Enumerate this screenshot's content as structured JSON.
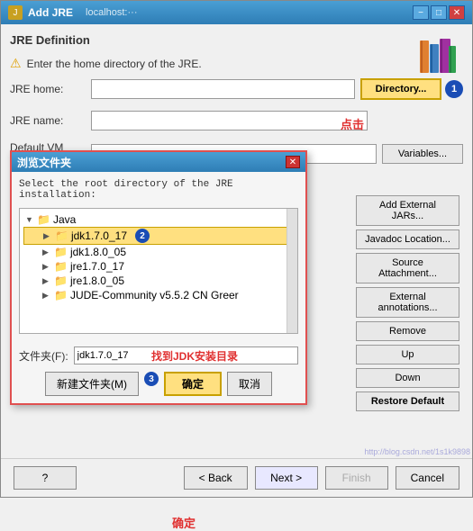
{
  "window": {
    "title": "Add JRE",
    "title_extra": "localhost:···",
    "close_label": "✕",
    "minimize_label": "−",
    "maximize_label": "□"
  },
  "section": {
    "title": "JRE Definition",
    "warning": "Enter the home directory of the JRE."
  },
  "form": {
    "jre_home_label": "JRE home:",
    "jre_name_label": "JRE name:",
    "default_vm_label": "Default VM arguments:"
  },
  "buttons": {
    "directory_label": "Directory...",
    "variables_label": "Variables...",
    "add_external_jars_label": "Add External JARs...",
    "javadoc_location_label": "Javadoc Location...",
    "source_attachment_label": "Source Attachment...",
    "external_annotations_label": "External annotations...",
    "remove_label": "Remove",
    "up_label": "Up",
    "down_label": "Down",
    "restore_default_label": "Restore Default"
  },
  "browse_dialog": {
    "title": "浏览文件夹",
    "instruction": "Select the root directory of the JRE\ninstallation:",
    "folder_label": "文件夹(F):",
    "folder_value": "jdk1.7.0_17",
    "new_folder_label": "新建文件夹(M)",
    "ok_label": "确定",
    "cancel_label": "取消",
    "tree": [
      {
        "indent": 0,
        "expanded": true,
        "icon": "📁",
        "label": "Java",
        "arrow": "▼"
      },
      {
        "indent": 1,
        "expanded": true,
        "icon": "📁",
        "label": "jdk1.7.0_17",
        "arrow": "▶",
        "selected": true
      },
      {
        "indent": 1,
        "expanded": false,
        "icon": "📁",
        "label": "jdk1.8.0_05",
        "arrow": "▶"
      },
      {
        "indent": 1,
        "expanded": false,
        "icon": "📁",
        "label": "jre1.7.0_17",
        "arrow": "▶"
      },
      {
        "indent": 1,
        "expanded": false,
        "icon": "📁",
        "label": "jre1.8.0_05",
        "arrow": "▶"
      },
      {
        "indent": 1,
        "expanded": false,
        "icon": "📁",
        "label": "JUDE-Community v5.5.2 CN Greer",
        "arrow": "▶"
      }
    ]
  },
  "annotations": {
    "click_label": "点击",
    "find_jdk_label": "找到JDK安装目录",
    "ok_confirm_label": "确定",
    "num1": "1",
    "num2": "2",
    "num3": "3"
  },
  "bottom_bar": {
    "back_label": "< Back",
    "next_label": "Next >",
    "finish_label": "Finish",
    "cancel_label": "Cancel"
  },
  "watermark": "http://blog.csdn.net/1s1k9898"
}
